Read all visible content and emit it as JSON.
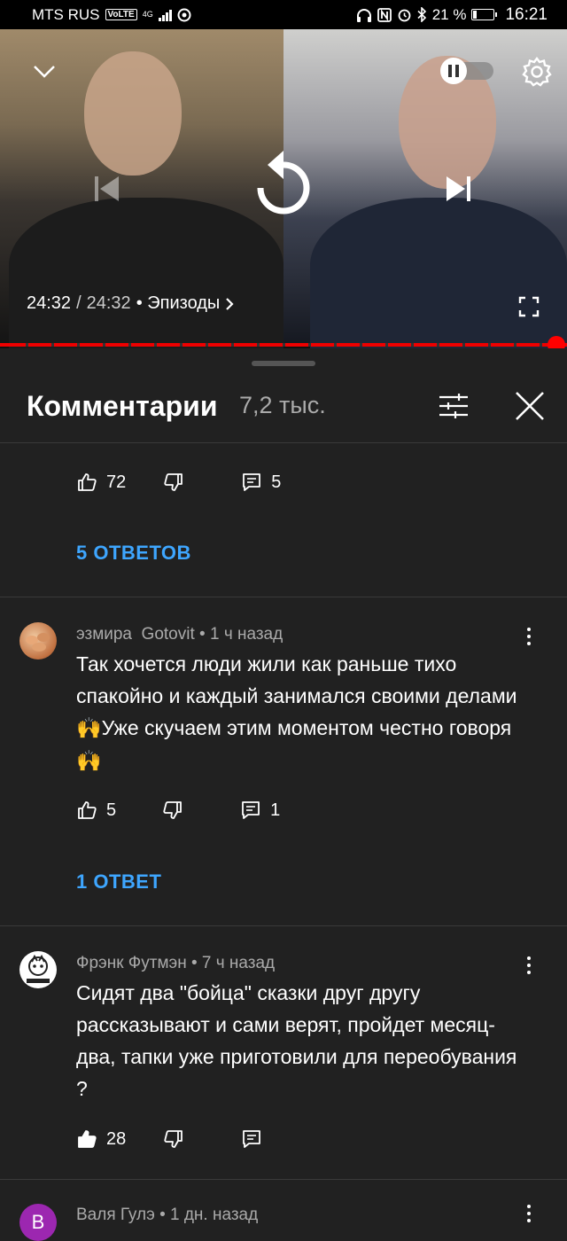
{
  "status_bar": {
    "carrier": "MTS RUS",
    "volte": "VoLTE",
    "network": "4G",
    "battery": "21 %",
    "battery_level": 0.21,
    "time": "16:21"
  },
  "player": {
    "current_time": "24:32",
    "separator": "/",
    "duration": "24:32",
    "episodes_label": "• Эпизоды",
    "progress": 1.0,
    "autoplay_on": false
  },
  "comments": {
    "title": "Комментарии",
    "count": "7,2 тыс.",
    "items": [
      {
        "likes": "72",
        "replies": "5",
        "replies_link": "5 ОТВЕТОВ"
      },
      {
        "author": "эзмира  Gotovit",
        "time": "• 1 ч назад",
        "text": "Так хочется люди жили как раньше тихо спакойно и каждый занимался своими делами🙌Уже скучаем этим моментом честно говоря🙌",
        "likes": "5",
        "replies": "1",
        "replies_link": "1 ОТВЕТ"
      },
      {
        "author": "Фрэнк Футмэн",
        "time": "• 7 ч назад",
        "text": "Сидят два \"бойца\" сказки друг другу рассказывают и сами верят, пройдет месяц-два, тапки уже приготовили для переобувания ?",
        "likes": "28",
        "replies": ""
      },
      {
        "author": "Валя Гулэ",
        "time": "• 1 дн. назад",
        "avatar_letter": "В"
      }
    ]
  },
  "colors": {
    "background": "#212121",
    "link": "#3ea6ff",
    "progress": "#ff0000"
  }
}
